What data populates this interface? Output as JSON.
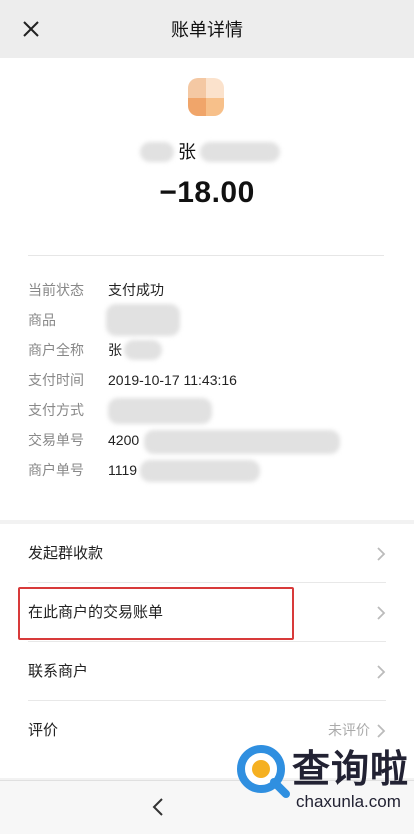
{
  "header": {
    "title": "账单详情",
    "close_icon": "close-icon"
  },
  "bill": {
    "payee_name_visible": "张",
    "amount": "−18.00",
    "details": [
      {
        "label": "当前状态",
        "value": "支付成功"
      },
      {
        "label": "商品",
        "value": ""
      },
      {
        "label": "商户全称",
        "value": "张"
      },
      {
        "label": "支付时间",
        "value": "2019-10-17 11:43:16"
      },
      {
        "label": "支付方式",
        "value": ""
      },
      {
        "label": "交易单号",
        "value": "4200"
      },
      {
        "label": "商户单号",
        "value": "1119"
      }
    ]
  },
  "actions": [
    {
      "label": "发起群收款",
      "status": ""
    },
    {
      "label": "在此商户的交易账单",
      "status": ""
    },
    {
      "label": "联系商户",
      "status": ""
    },
    {
      "label": "评价",
      "status": "未评价"
    }
  ],
  "colors": {
    "highlight_border": "#d83a3a",
    "background": "#f2f2f2"
  },
  "watermark": {
    "text": "查询啦",
    "domain": "chaxunla.com"
  }
}
